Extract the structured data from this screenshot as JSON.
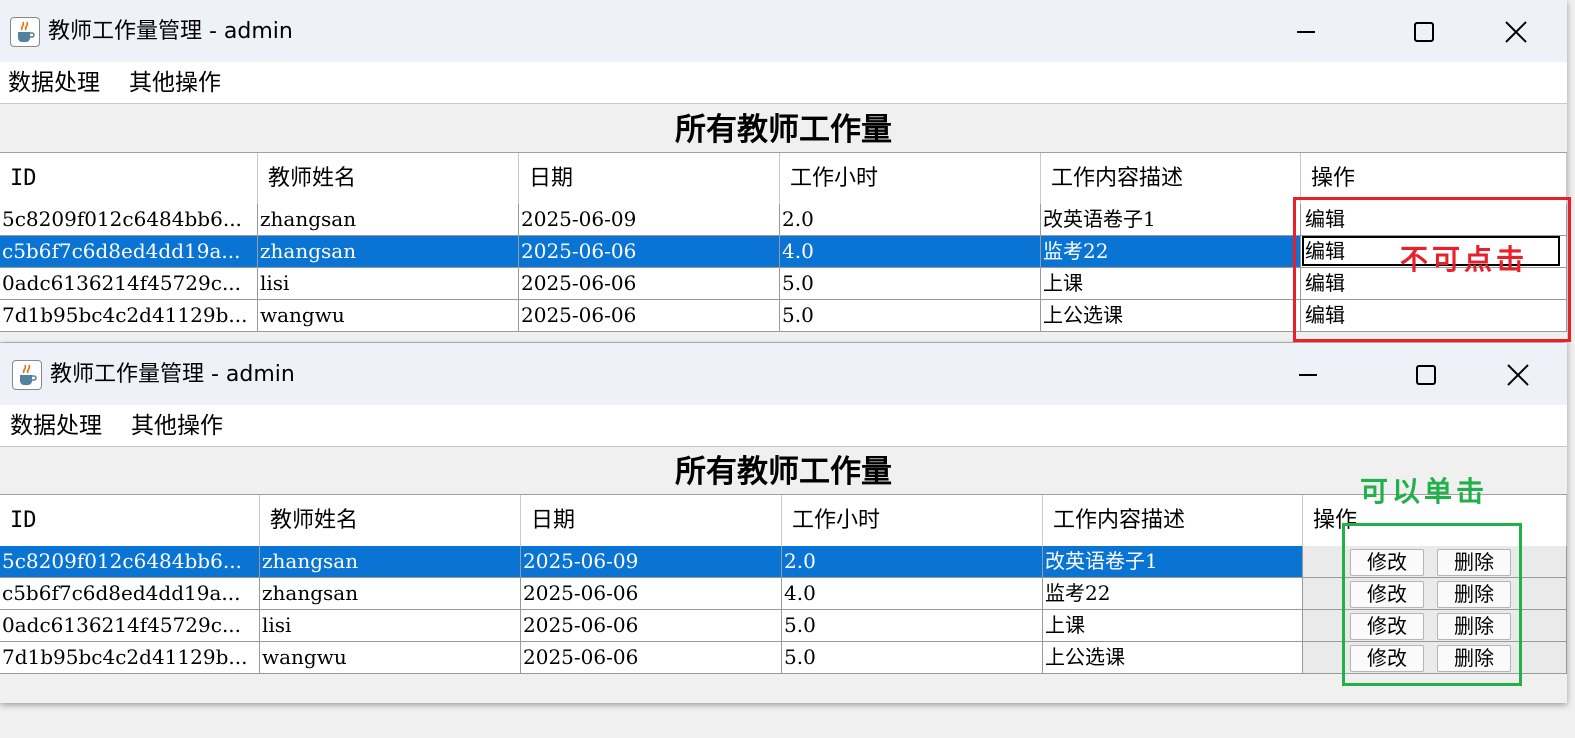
{
  "windows": [
    {
      "title": "教师工作量管理 - admin",
      "menu": [
        "数据处理",
        "其他操作"
      ],
      "heading": "所有教师工作量",
      "columns": [
        "ID",
        "教师姓名",
        "日期",
        "工作小时",
        "工作内容描述",
        "操作"
      ],
      "rows": [
        {
          "id": "5c8209f012c6484bb6...",
          "name": "zhangsan",
          "date": "2025-06-09",
          "hours": "2.0",
          "desc": "改英语卷子1",
          "op": "编辑"
        },
        {
          "id": "c5b6f7c6d8ed4dd19a...",
          "name": "zhangsan",
          "date": "2025-06-06",
          "hours": "4.0",
          "desc": "监考22",
          "op": "编辑"
        },
        {
          "id": "0adc6136214f45729c...",
          "name": "lisi",
          "date": "2025-06-06",
          "hours": "5.0",
          "desc": "上课",
          "op": "编辑"
        },
        {
          "id": "7d1b95bc4c2d41129b...",
          "name": "wangwu",
          "date": "2025-06-06",
          "hours": "5.0",
          "desc": "上公选课",
          "op": "编辑"
        }
      ],
      "selected_row": 1
    },
    {
      "title": "教师工作量管理 - admin",
      "menu": [
        "数据处理",
        "其他操作"
      ],
      "heading": "所有教师工作量",
      "columns": [
        "ID",
        "教师姓名",
        "日期",
        "工作小时",
        "工作内容描述",
        "操作"
      ],
      "rows": [
        {
          "id": "5c8209f012c6484bb6...",
          "name": "zhangsan",
          "date": "2025-06-09",
          "hours": "2.0",
          "desc": "改英语卷子1",
          "edit": "修改",
          "delete": "删除"
        },
        {
          "id": "c5b6f7c6d8ed4dd19a...",
          "name": "zhangsan",
          "date": "2025-06-06",
          "hours": "4.0",
          "desc": "监考22",
          "edit": "修改",
          "delete": "删除"
        },
        {
          "id": "0adc6136214f45729c...",
          "name": "lisi",
          "date": "2025-06-06",
          "hours": "5.0",
          "desc": "上课",
          "edit": "修改",
          "delete": "删除"
        },
        {
          "id": "7d1b95bc4c2d41129b...",
          "name": "wangwu",
          "date": "2025-06-06",
          "hours": "5.0",
          "desc": "上公选课",
          "edit": "修改",
          "delete": "删除"
        }
      ],
      "selected_row": 0
    }
  ],
  "annotations": {
    "red_label": "不可点击",
    "green_label": "可以单击",
    "red_color": "#e8202a",
    "green_color": "#22b04b"
  },
  "colors": {
    "selection": "#0a74d4",
    "titlebar": "#eef2f8"
  },
  "icons": {
    "app": "java-coffee-icon",
    "minimize": "minimize-icon",
    "maximize": "maximize-icon",
    "close": "close-icon"
  }
}
